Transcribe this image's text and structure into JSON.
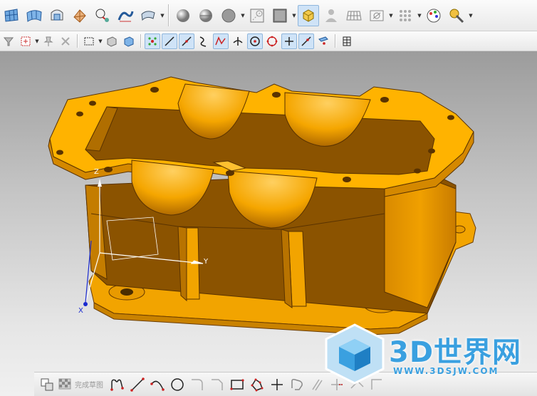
{
  "toolbar_row1": {
    "icons": [
      "surface-grid-icon",
      "surface-mesh-icon",
      "swept-surface-icon",
      "n-sided-surface-icon",
      "bridge-surface-icon",
      "styled-blend-icon",
      "sheet-extend-icon",
      "shaded-sphere-icon",
      "shaded-disk-icon",
      "gray-sphere-icon",
      "hidden-edge-icon",
      "shaded-box-icon",
      "render-style-icon",
      "user-figure-icon",
      "grid-plane-icon",
      "clip-section-icon",
      "dot-grid-icon",
      "palette-icon",
      "wrench-settings-icon"
    ]
  },
  "toolbar_row2": {
    "icons": [
      "snap-filter-icon",
      "select-plus-icon",
      "pin-icon",
      "move-handle-icon",
      "box-select-icon",
      "cube-view-icon",
      "solid-cube-icon",
      "point-on-curve-icon",
      "line-end-icon",
      "line-mid-icon",
      "curve-snap-icon",
      "control-point-icon",
      "intersection-icon",
      "arc-center-icon",
      "quadrant-icon",
      "existing-point-icon",
      "pole-point-icon",
      "face-point-icon",
      "grid-select-icon"
    ]
  },
  "triad": {
    "x_label": "X",
    "y_label": "Y",
    "z_label": "Z"
  },
  "bottom_toolbar": {
    "finish_sketch_label": "完成草图",
    "tools": [
      "profile-icon",
      "line-icon",
      "arc-icon",
      "circle-icon",
      "fillet-icon",
      "chamfer-icon",
      "rectangle-icon",
      "polygon-icon",
      "point-icon",
      "studio-spline-icon",
      "offset-curve-icon",
      "trim-icon",
      "extend-icon",
      "corner-icon"
    ]
  },
  "watermark": {
    "title": "3D世界网",
    "url": "WWW.3DSJW.COM"
  },
  "colors": {
    "model_top": "#ffb300",
    "model_side": "#e89500",
    "model_dark": "#8a5600",
    "accent_blue": "#3aa0e0"
  }
}
